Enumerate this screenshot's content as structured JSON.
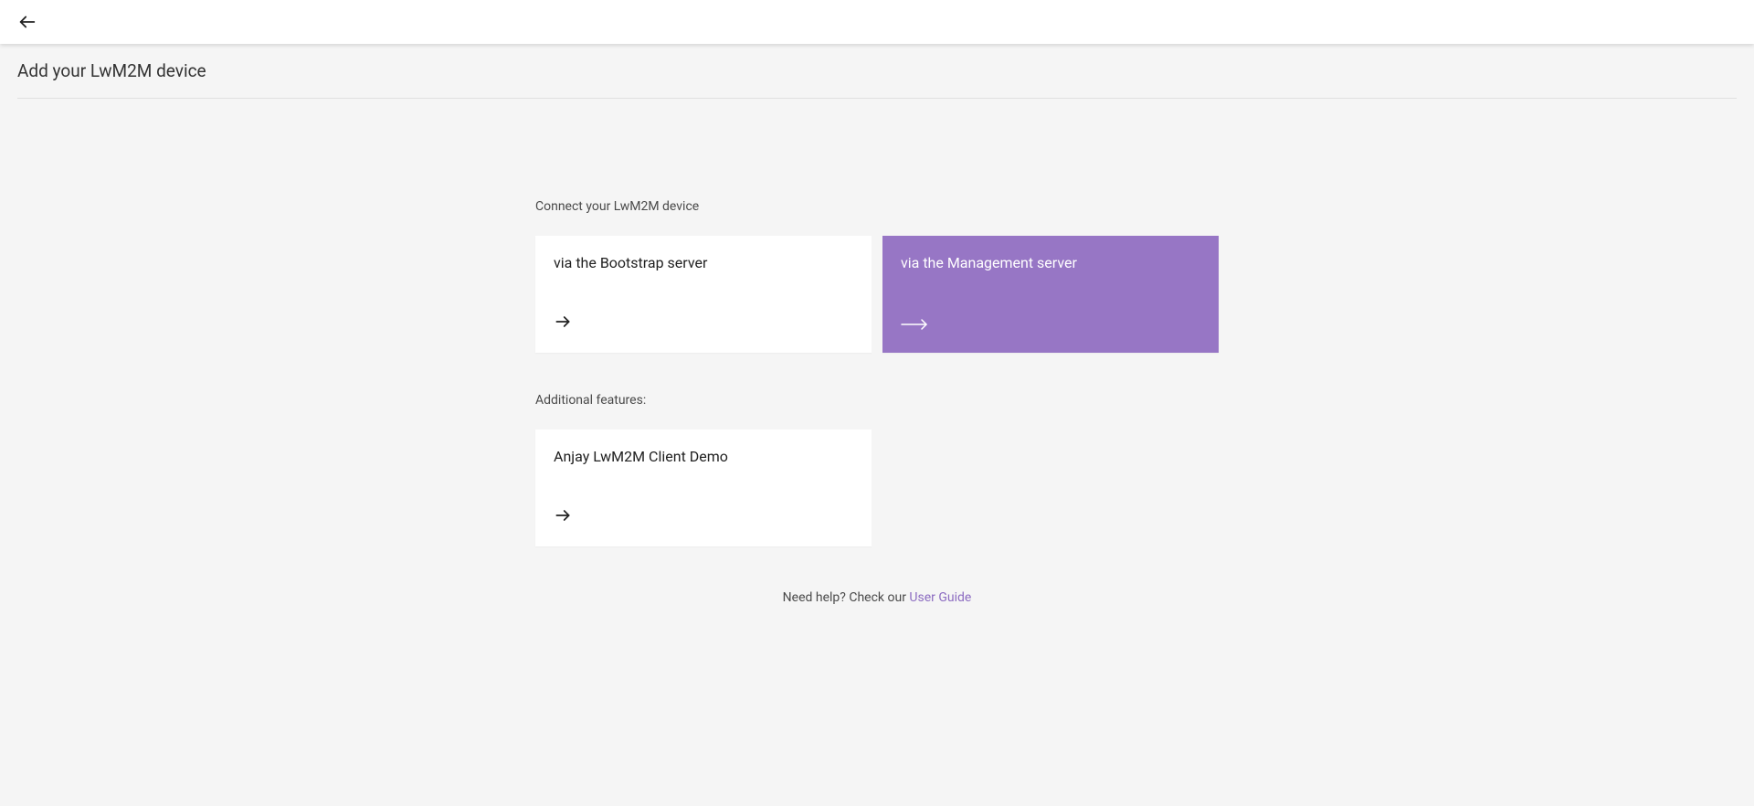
{
  "page": {
    "title": "Add your LwM2M device"
  },
  "sections": {
    "connect": {
      "label": "Connect your LwM2M device",
      "cards": [
        {
          "title": "via the Bootstrap server",
          "active": false
        },
        {
          "title": "via the Management server",
          "active": true
        }
      ]
    },
    "additional": {
      "label": "Additional features:",
      "cards": [
        {
          "title": "Anjay LwM2M Client Demo",
          "active": false
        }
      ]
    }
  },
  "help": {
    "text": "Need help? Check our ",
    "linkLabel": "User Guide"
  }
}
